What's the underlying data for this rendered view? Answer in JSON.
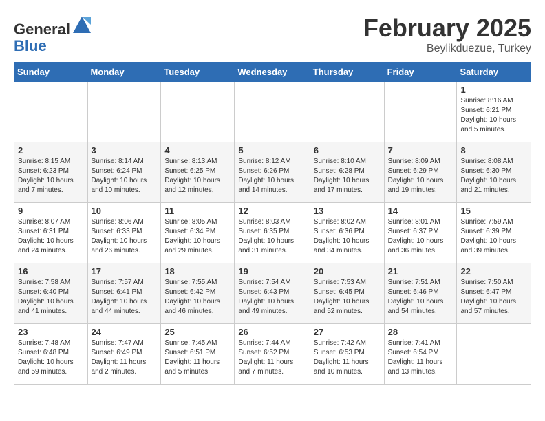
{
  "header": {
    "logo_line1": "General",
    "logo_line2": "Blue",
    "title": "February 2025",
    "subtitle": "Beylikduezue, Turkey"
  },
  "weekdays": [
    "Sunday",
    "Monday",
    "Tuesday",
    "Wednesday",
    "Thursday",
    "Friday",
    "Saturday"
  ],
  "weeks": [
    [
      {
        "day": "",
        "info": ""
      },
      {
        "day": "",
        "info": ""
      },
      {
        "day": "",
        "info": ""
      },
      {
        "day": "",
        "info": ""
      },
      {
        "day": "",
        "info": ""
      },
      {
        "day": "",
        "info": ""
      },
      {
        "day": "1",
        "info": "Sunrise: 8:16 AM\nSunset: 6:21 PM\nDaylight: 10 hours and 5 minutes."
      }
    ],
    [
      {
        "day": "2",
        "info": "Sunrise: 8:15 AM\nSunset: 6:23 PM\nDaylight: 10 hours and 7 minutes."
      },
      {
        "day": "3",
        "info": "Sunrise: 8:14 AM\nSunset: 6:24 PM\nDaylight: 10 hours and 10 minutes."
      },
      {
        "day": "4",
        "info": "Sunrise: 8:13 AM\nSunset: 6:25 PM\nDaylight: 10 hours and 12 minutes."
      },
      {
        "day": "5",
        "info": "Sunrise: 8:12 AM\nSunset: 6:26 PM\nDaylight: 10 hours and 14 minutes."
      },
      {
        "day": "6",
        "info": "Sunrise: 8:10 AM\nSunset: 6:28 PM\nDaylight: 10 hours and 17 minutes."
      },
      {
        "day": "7",
        "info": "Sunrise: 8:09 AM\nSunset: 6:29 PM\nDaylight: 10 hours and 19 minutes."
      },
      {
        "day": "8",
        "info": "Sunrise: 8:08 AM\nSunset: 6:30 PM\nDaylight: 10 hours and 21 minutes."
      }
    ],
    [
      {
        "day": "9",
        "info": "Sunrise: 8:07 AM\nSunset: 6:31 PM\nDaylight: 10 hours and 24 minutes."
      },
      {
        "day": "10",
        "info": "Sunrise: 8:06 AM\nSunset: 6:33 PM\nDaylight: 10 hours and 26 minutes."
      },
      {
        "day": "11",
        "info": "Sunrise: 8:05 AM\nSunset: 6:34 PM\nDaylight: 10 hours and 29 minutes."
      },
      {
        "day": "12",
        "info": "Sunrise: 8:03 AM\nSunset: 6:35 PM\nDaylight: 10 hours and 31 minutes."
      },
      {
        "day": "13",
        "info": "Sunrise: 8:02 AM\nSunset: 6:36 PM\nDaylight: 10 hours and 34 minutes."
      },
      {
        "day": "14",
        "info": "Sunrise: 8:01 AM\nSunset: 6:37 PM\nDaylight: 10 hours and 36 minutes."
      },
      {
        "day": "15",
        "info": "Sunrise: 7:59 AM\nSunset: 6:39 PM\nDaylight: 10 hours and 39 minutes."
      }
    ],
    [
      {
        "day": "16",
        "info": "Sunrise: 7:58 AM\nSunset: 6:40 PM\nDaylight: 10 hours and 41 minutes."
      },
      {
        "day": "17",
        "info": "Sunrise: 7:57 AM\nSunset: 6:41 PM\nDaylight: 10 hours and 44 minutes."
      },
      {
        "day": "18",
        "info": "Sunrise: 7:55 AM\nSunset: 6:42 PM\nDaylight: 10 hours and 46 minutes."
      },
      {
        "day": "19",
        "info": "Sunrise: 7:54 AM\nSunset: 6:43 PM\nDaylight: 10 hours and 49 minutes."
      },
      {
        "day": "20",
        "info": "Sunrise: 7:53 AM\nSunset: 6:45 PM\nDaylight: 10 hours and 52 minutes."
      },
      {
        "day": "21",
        "info": "Sunrise: 7:51 AM\nSunset: 6:46 PM\nDaylight: 10 hours and 54 minutes."
      },
      {
        "day": "22",
        "info": "Sunrise: 7:50 AM\nSunset: 6:47 PM\nDaylight: 10 hours and 57 minutes."
      }
    ],
    [
      {
        "day": "23",
        "info": "Sunrise: 7:48 AM\nSunset: 6:48 PM\nDaylight: 10 hours and 59 minutes."
      },
      {
        "day": "24",
        "info": "Sunrise: 7:47 AM\nSunset: 6:49 PM\nDaylight: 11 hours and 2 minutes."
      },
      {
        "day": "25",
        "info": "Sunrise: 7:45 AM\nSunset: 6:51 PM\nDaylight: 11 hours and 5 minutes."
      },
      {
        "day": "26",
        "info": "Sunrise: 7:44 AM\nSunset: 6:52 PM\nDaylight: 11 hours and 7 minutes."
      },
      {
        "day": "27",
        "info": "Sunrise: 7:42 AM\nSunset: 6:53 PM\nDaylight: 11 hours and 10 minutes."
      },
      {
        "day": "28",
        "info": "Sunrise: 7:41 AM\nSunset: 6:54 PM\nDaylight: 11 hours and 13 minutes."
      },
      {
        "day": "",
        "info": ""
      }
    ]
  ]
}
